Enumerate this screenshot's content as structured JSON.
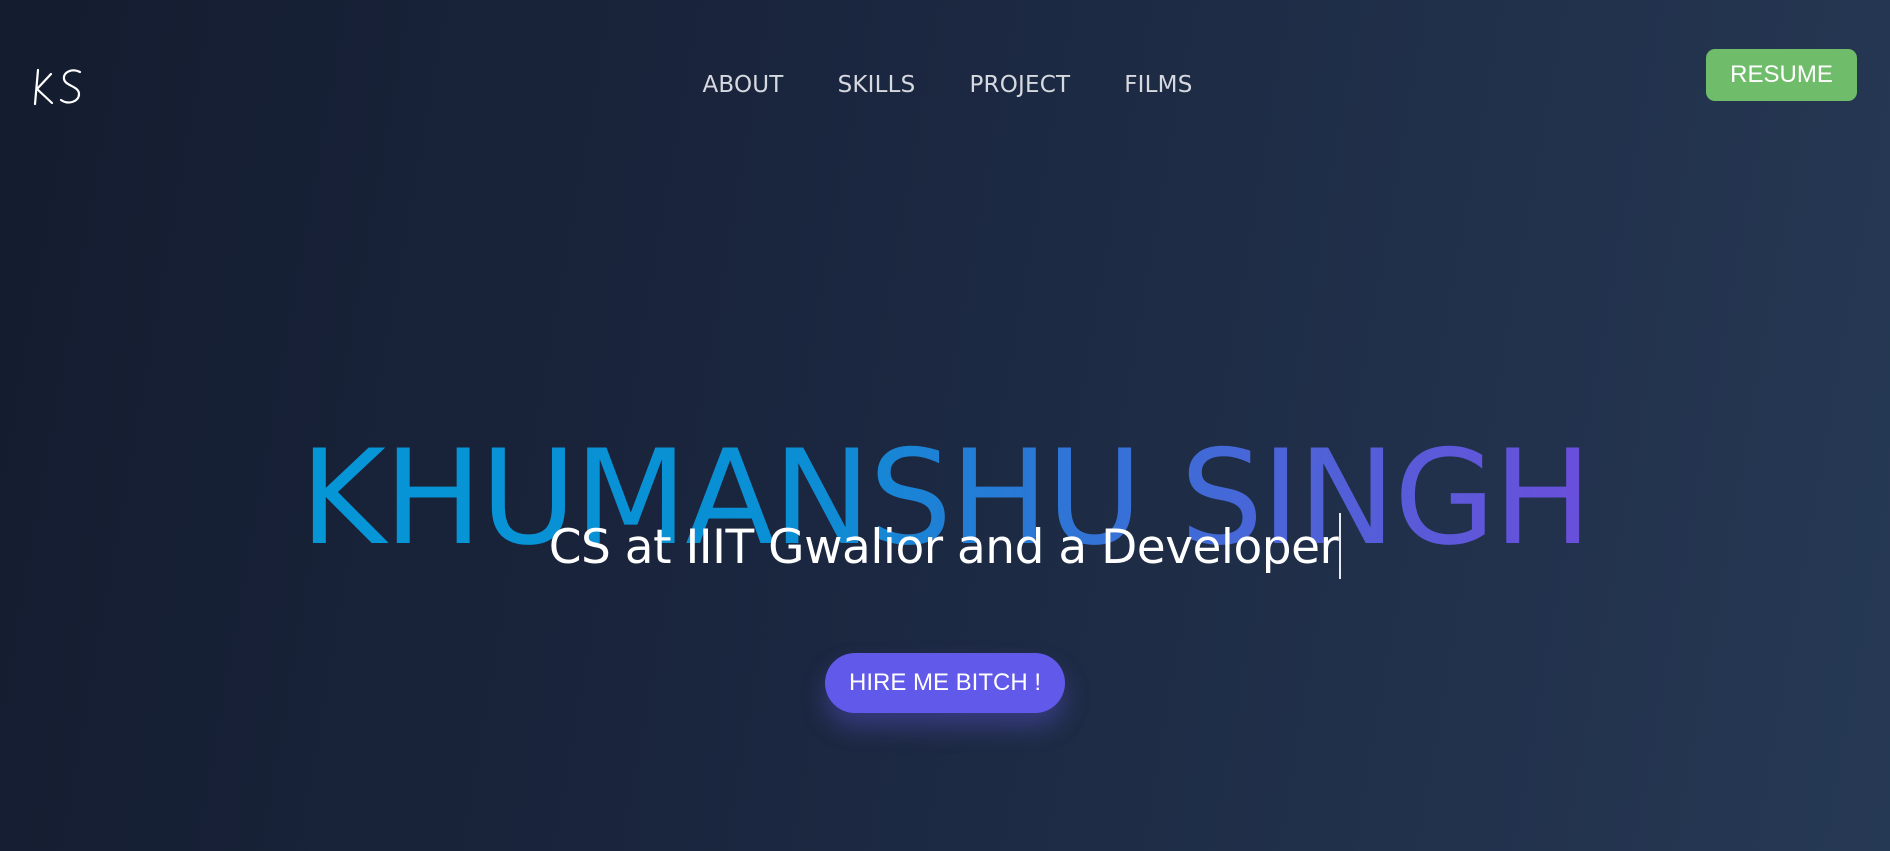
{
  "logo": {
    "text": "KS"
  },
  "nav": {
    "items": [
      {
        "label": "ABOUT"
      },
      {
        "label": "SKILLS"
      },
      {
        "label": "PROJECT"
      },
      {
        "label": "FILMS"
      }
    ]
  },
  "resume_button": {
    "label": "RESUME",
    "color": "#6fbd6a"
  },
  "hero": {
    "name": "KHUMANSHU SINGH",
    "subtitle": "CS at IIIT Gwalior and a Developer",
    "cta_label": "HIRE ME BITCH !",
    "gradient_start": "#0596d6",
    "gradient_end": "#6a4fdb",
    "cta_color": "#6159ea"
  },
  "background": {
    "from": "#141c2f",
    "to": "#263954"
  }
}
